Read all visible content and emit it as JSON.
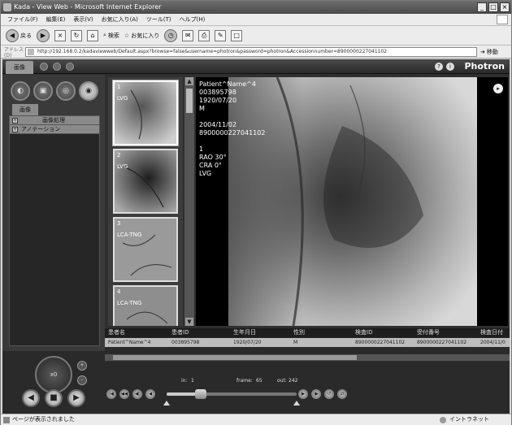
{
  "window": {
    "title": "Kada - View Web - Microsoft Internet Explorer"
  },
  "menu": [
    "ファイル(F)",
    "編集(E)",
    "表示(V)",
    "お気に入り(A)",
    "ツール(T)",
    "ヘルプ(H)"
  ],
  "toolbar": {
    "back": "戻る",
    "search": "検索",
    "favorites": "お気に入り"
  },
  "address": {
    "label": "アドレス(D)",
    "url": "http://192.168.0.2/kadaviewweb/Default.aspx?browse=false&username=photron&password=photron&Accessionnumber=8900000227041102",
    "go": "移動"
  },
  "app": {
    "tab": "画像",
    "brand": "Photron",
    "left_tab": "画像",
    "tree": [
      {
        "label": "画像処理"
      },
      {
        "label": "アノテーション"
      }
    ],
    "jog_label": "x0"
  },
  "thumbnails": [
    {
      "num": "1",
      "caption": "LVG"
    },
    {
      "num": "2",
      "caption": "LVG"
    },
    {
      "num": "3",
      "caption": "LCA-TNG"
    },
    {
      "num": "4",
      "caption": "LCA-TNG"
    }
  ],
  "overlay": {
    "name": "Patient^Name^4",
    "id": "003895798",
    "dob": "1920/07/20",
    "sex": "M",
    "study_date": "2004/11/02",
    "accession": "8900000227041102",
    "series": "1",
    "rao": "RAO 30°",
    "cra": "CRA 0°",
    "desc": "LVG"
  },
  "study_table": {
    "headers": [
      "患者名",
      "患者ID",
      "生年月日",
      "性別",
      "検査ID",
      "受付番号",
      "検査日付"
    ],
    "row": [
      "Patient^Name^4",
      "003895798",
      "1920/07/20",
      "M",
      "8900000227041102",
      "8900000227041102",
      "2004/11/0"
    ]
  },
  "frame": {
    "in_label": "in:",
    "in_value": "1",
    "frame_label": "frame:",
    "frame_value": "65",
    "out_label": "out:",
    "out_value": "242",
    "position": 0.26
  },
  "status": {
    "text": "ページが表示されました",
    "zone": "イントラネット"
  }
}
